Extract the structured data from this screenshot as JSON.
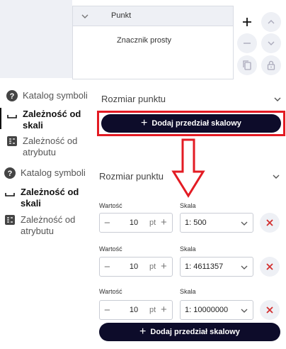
{
  "layer_tree": {
    "group_title": "Punkt",
    "item": "Znacznik prosty"
  },
  "left_menu_a": {
    "catalog": "Katalog symboli",
    "scale_dep_line1": "Zależność od",
    "scale_dep_line2": "skali",
    "attr_dep_line1": "Zależność od",
    "attr_dep_line2": "atrybutu"
  },
  "left_menu_b": {
    "catalog": "Katalog symboli",
    "scale_dep_line1": "Zależność od",
    "scale_dep_line2": "skali",
    "attr_dep_line1": "Zależność od",
    "attr_dep_line2": "atrybutu"
  },
  "section_a": {
    "title": "Rozmiar punktu",
    "add_button": "Dodaj przedział skalowy"
  },
  "section_b": {
    "title": "Rozmiar punktu",
    "rows": [
      {
        "value_label": "Wartość",
        "value": "10",
        "unit": "pt",
        "scale_label": "Skala",
        "scale": "1: 500"
      },
      {
        "value_label": "Wartość",
        "value": "10",
        "unit": "pt",
        "scale_label": "Skala",
        "scale": "1: 4611357"
      },
      {
        "value_label": "Wartość",
        "value": "10",
        "unit": "pt",
        "scale_label": "Skala",
        "scale": "1: 10000000"
      }
    ],
    "add_button": "Dodaj przedział skalowy"
  },
  "colors": {
    "accent_dark": "#0d0c2a",
    "highlight_red": "#e31b23",
    "delete_red": "#d32f2f"
  }
}
